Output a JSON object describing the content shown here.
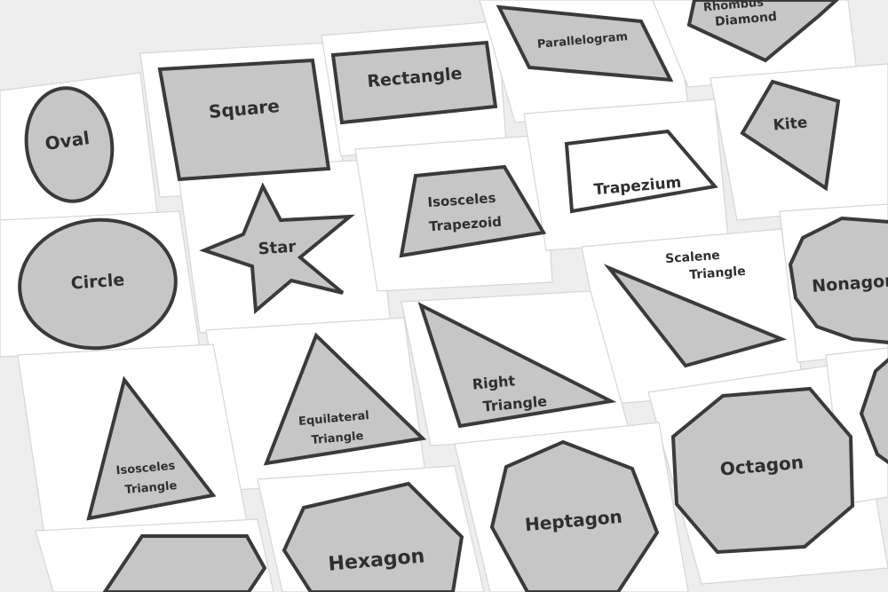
{
  "labels": {
    "oval": "Oval",
    "square": "Square",
    "rectangle": "Rectangle",
    "parallelogram": "Parallelogram",
    "rhombus_line1": "Rhombus",
    "rhombus_line2": "Diamond",
    "kite": "Kite",
    "star": "Star",
    "isosceles_trapezoid_line1": "Isosceles",
    "isosceles_trapezoid_line2": "Trapezoid",
    "trapezium": "Trapezium",
    "circle": "Circle",
    "scalene_triangle_line1": "Scalene",
    "scalene_triangle_line2": "Triangle",
    "nonagon": "Nonagon",
    "equilateral_triangle_line1": "Equilateral",
    "equilateral_triangle_line2": "Triangle",
    "right_triangle_line1": "Right",
    "right_triangle_line2": "Triangle",
    "isosceles_triangle_line1": "Isosceles",
    "isosceles_triangle_line2": "Triangle",
    "octagon": "Octagon",
    "heptagon": "Heptagon",
    "hexagon": "Hexagon"
  },
  "colors": {
    "background": "#eeeeee",
    "card": "#ffffff",
    "shape_fill": "#c6c6c6",
    "outline": "#3a3a3a",
    "text": "#2f2f2f"
  }
}
